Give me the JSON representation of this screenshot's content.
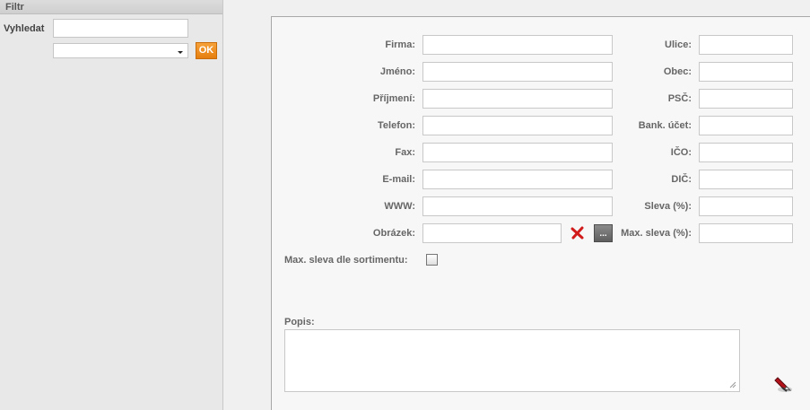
{
  "sidebar": {
    "header": "Filtr",
    "search_label": "Vyhledat",
    "search_value": "",
    "select_value": "",
    "ok_label": "OK"
  },
  "form": {
    "left": [
      {
        "label": "Firma:",
        "value": ""
      },
      {
        "label": "Jméno:",
        "value": ""
      },
      {
        "label": "Příjmení:",
        "value": ""
      },
      {
        "label": "Telefon:",
        "value": ""
      },
      {
        "label": "Fax:",
        "value": ""
      },
      {
        "label": "E-mail:",
        "value": ""
      },
      {
        "label": "WWW:",
        "value": ""
      },
      {
        "label": "Obrázek:",
        "value": ""
      }
    ],
    "right": [
      {
        "label": "Ulice:",
        "value": ""
      },
      {
        "label": "Obec:",
        "value": ""
      },
      {
        "label": "PSČ:",
        "value": ""
      },
      {
        "label": "Bank. účet:",
        "value": ""
      },
      {
        "label": "IČO:",
        "value": ""
      },
      {
        "label": "DIČ:",
        "value": ""
      },
      {
        "label": "Sleva (%):",
        "value": ""
      },
      {
        "label": "Max. sleva (%):",
        "value": ""
      }
    ],
    "browse_label": "...",
    "max_discount_checkbox_label": "Max. sleva dle sortimentu:",
    "max_discount_checked": false,
    "description_label": "Popis:",
    "description_value": ""
  },
  "icons": {
    "clear": "close-x-icon",
    "edit": "edit-pencil-icon",
    "accent": "#e8870f",
    "clear_color": "#d11a1a"
  }
}
